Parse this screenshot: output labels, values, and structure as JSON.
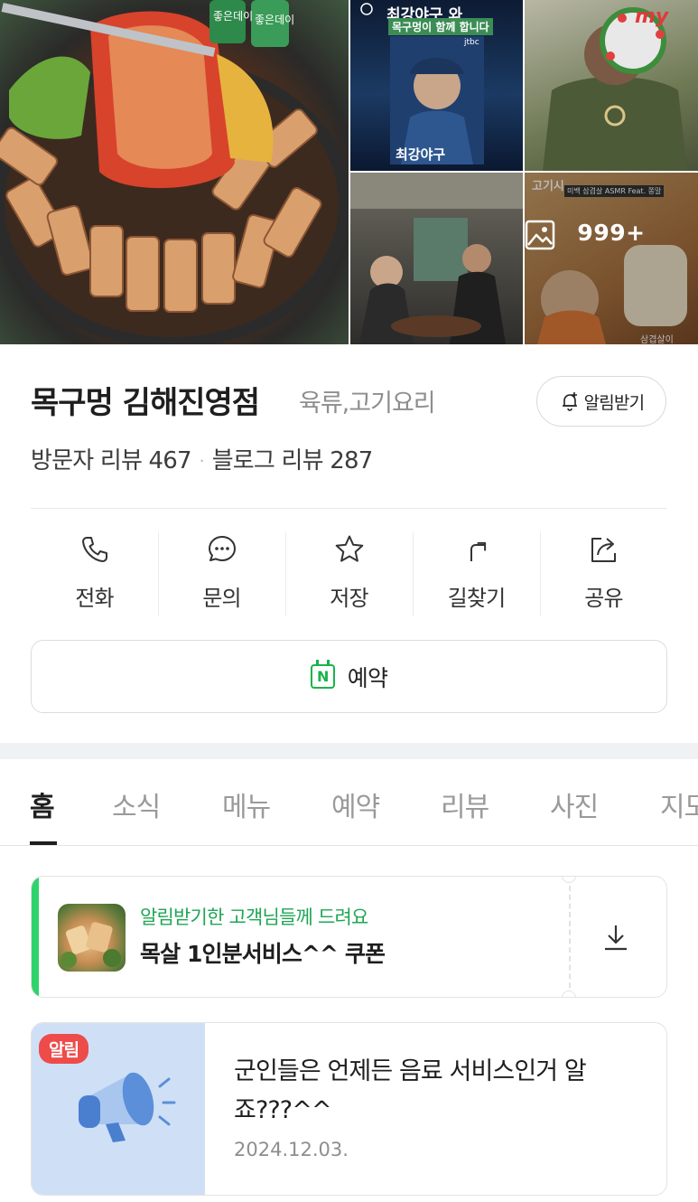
{
  "photos": {
    "poster_title": "최강야구",
    "poster_sub": "목구멍이 함께 합니다",
    "poster_tag": "최강야구 와",
    "poster_logo": "jtbc",
    "watermark": "my",
    "photo_count": "999+",
    "thumb_tag": "삼겹살이",
    "thumb_corner": "고기시",
    "thumb_top_strip": "미백 삼겹살 ASMR Feat. 쫑말",
    "bottle_label": "좋은데이"
  },
  "place": {
    "name": "목구멍 김해진영점",
    "category": "육류,고기요리",
    "notify_label": "알림받기",
    "visitor_reviews": "방문자 리뷰 467",
    "blog_reviews": "블로그 리뷰 287",
    "separator": "·"
  },
  "actions": [
    {
      "label": "전화",
      "icon": "phone-icon"
    },
    {
      "label": "문의",
      "icon": "chat-icon"
    },
    {
      "label": "저장",
      "icon": "star-icon"
    },
    {
      "label": "길찾기",
      "icon": "directions-icon"
    },
    {
      "label": "공유",
      "icon": "share-icon"
    }
  ],
  "reserve": {
    "label": "예약",
    "badge": "N"
  },
  "tabs": [
    "홈",
    "소식",
    "메뉴",
    "예약",
    "리뷰",
    "사진",
    "지도"
  ],
  "active_tab": "홈",
  "coupon": {
    "subtitle": "알림받기한 고객님들께 드려요",
    "title": "목살 1인분서비스^^ 쿠폰"
  },
  "notice": {
    "badge": "알림",
    "title": "군인들은 언제든 음료 서비스인거 알죠???^^",
    "date": "2024.12.03."
  },
  "colors": {
    "accent_green": "#1ea655",
    "coupon_bar": "#2ed36b",
    "badge_red": "#ee4b4b",
    "notice_bg": "#cfe0f6"
  }
}
